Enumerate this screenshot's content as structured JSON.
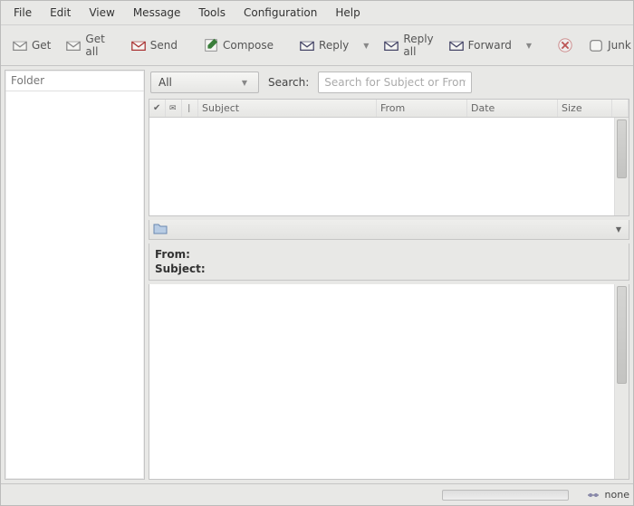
{
  "menu": {
    "items": [
      "File",
      "Edit",
      "View",
      "Message",
      "Tools",
      "Configuration",
      "Help"
    ]
  },
  "toolbar": {
    "get": "Get",
    "get_all": "Get all",
    "send": "Send",
    "compose": "Compose",
    "reply": "Reply",
    "reply_all": "Reply all",
    "forward": "Forward",
    "junk": "Junk"
  },
  "sidebar": {
    "title": "Folder"
  },
  "search": {
    "filter_selected": "All",
    "label": "Search:",
    "placeholder": "Search for Subject or From"
  },
  "columns": {
    "check": "✓",
    "flag": "✕",
    "att": "📎",
    "subject": "Subject",
    "from": "From",
    "date": "Date",
    "size": "Size"
  },
  "preview": {
    "from_label": "From:",
    "subject_label": "Subject:"
  },
  "status": {
    "net": "none"
  }
}
